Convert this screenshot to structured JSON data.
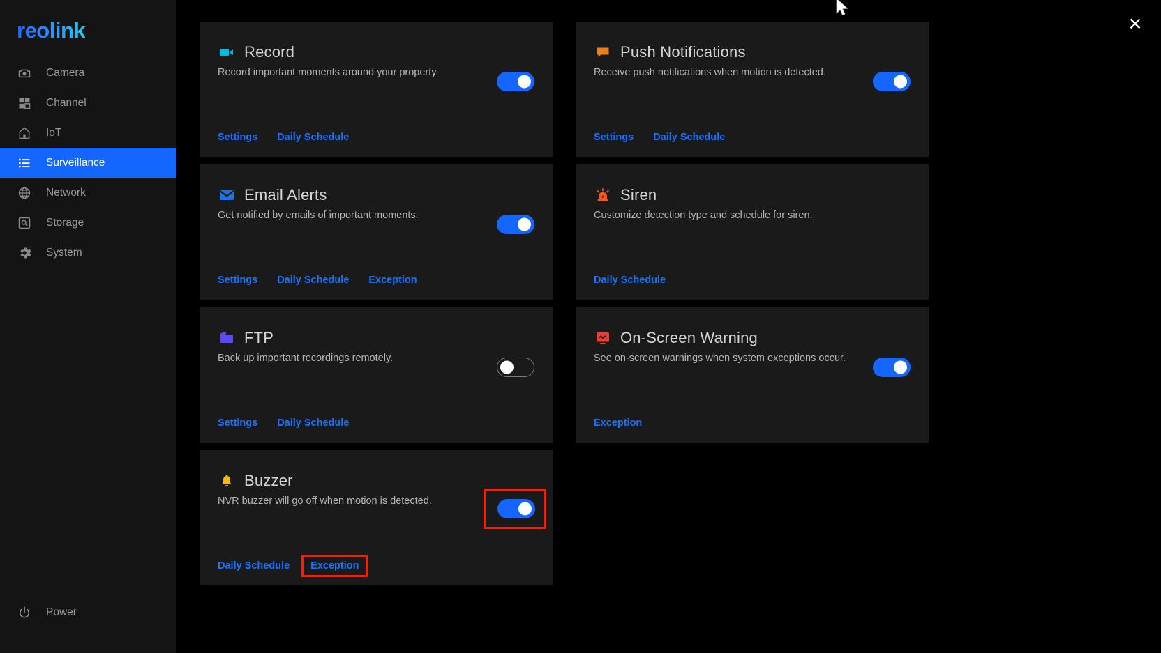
{
  "brand": {
    "logo_text": "reolink"
  },
  "sidebar": {
    "items": [
      {
        "label": "Camera",
        "icon": "camera-icon",
        "active": false
      },
      {
        "label": "Channel",
        "icon": "channel-icon",
        "active": false
      },
      {
        "label": "IoT",
        "icon": "iot-home-icon",
        "active": false
      },
      {
        "label": "Surveillance",
        "icon": "list-icon",
        "active": true
      },
      {
        "label": "Network",
        "icon": "globe-icon",
        "active": false
      },
      {
        "label": "Storage",
        "icon": "storage-disk-icon",
        "active": false
      },
      {
        "label": "System",
        "icon": "gear-icon",
        "active": false
      }
    ],
    "power": {
      "label": "Power",
      "icon": "power-icon"
    }
  },
  "titlebar": {
    "close_label": "✕",
    "close_icon": "close-icon"
  },
  "colors": {
    "accent_blue": "#1466ff",
    "link_blue": "#1a73ff",
    "highlight_red": "#ff1a00",
    "card_bg": "#1a1a1a",
    "sidebar_bg": "#141414",
    "page_bg": "#000000"
  },
  "cards": {
    "record": {
      "title": "Record",
      "description": "Record important moments around your property.",
      "icon": "camcorder-icon",
      "icon_color": "#00b9e0",
      "toggle": {
        "state": "on",
        "highlighted": false
      },
      "links": [
        {
          "label": "Settings",
          "highlighted": false
        },
        {
          "label": "Daily Schedule",
          "highlighted": false
        }
      ]
    },
    "push_notifications": {
      "title": "Push Notifications",
      "description": "Receive push notifications when motion is detected.",
      "icon": "speech-bubble-icon",
      "icon_color": "#ef7f17",
      "toggle": {
        "state": "on",
        "highlighted": false
      },
      "links": [
        {
          "label": "Settings",
          "highlighted": false
        },
        {
          "label": "Daily Schedule",
          "highlighted": false
        }
      ]
    },
    "email_alerts": {
      "title": "Email Alerts",
      "description": "Get notified by emails of important moments.",
      "icon": "envelope-icon",
      "icon_color": "#1b74e4",
      "toggle": {
        "state": "on",
        "highlighted": false
      },
      "links": [
        {
          "label": "Settings",
          "highlighted": false
        },
        {
          "label": "Daily Schedule",
          "highlighted": false
        },
        {
          "label": "Exception",
          "highlighted": false
        }
      ]
    },
    "siren": {
      "title": "Siren",
      "description": "Customize detection type and schedule for siren.",
      "icon": "siren-alarm-icon",
      "icon_color": "#f2571b",
      "toggle": {
        "state": "none",
        "highlighted": false
      },
      "links": [
        {
          "label": "Daily Schedule",
          "highlighted": false
        }
      ]
    },
    "ftp": {
      "title": "FTP",
      "description": "Back up important recordings remotely.",
      "icon": "folder-icon",
      "icon_color": "#5b4bf5",
      "toggle": {
        "state": "off",
        "highlighted": false
      },
      "links": [
        {
          "label": "Settings",
          "highlighted": false
        },
        {
          "label": "Daily Schedule",
          "highlighted": false
        }
      ]
    },
    "on_screen_warning": {
      "title": "On-Screen Warning",
      "description": "See on-screen warnings when system exceptions occur.",
      "icon": "screen-warning-icon",
      "icon_color": "#ee3b33",
      "toggle": {
        "state": "on",
        "highlighted": false
      },
      "links": [
        {
          "label": "Exception",
          "highlighted": false
        }
      ]
    },
    "buzzer": {
      "title": "Buzzer",
      "description": "NVR buzzer will go off when motion is detected.",
      "icon": "bell-icon",
      "icon_color": "#f0b918",
      "toggle": {
        "state": "on",
        "highlighted": true
      },
      "links": [
        {
          "label": "Daily Schedule",
          "highlighted": false
        },
        {
          "label": "Exception",
          "highlighted": true
        }
      ]
    }
  }
}
